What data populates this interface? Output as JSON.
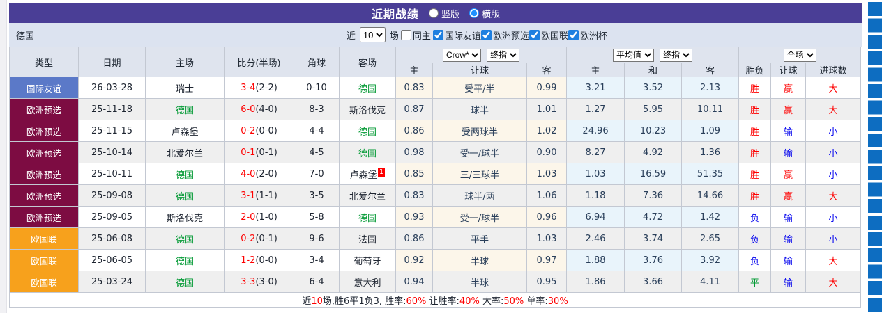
{
  "title_bar": {
    "title": "近期战绩",
    "layout_options": {
      "vertical": "竖版",
      "horizontal": "横版",
      "selected": "横版"
    }
  },
  "filter_bar": {
    "team": "德国",
    "recent_label": "近",
    "recent_value": "10",
    "matches_label": "场",
    "same_home_label": "同主",
    "same_home_checked": false,
    "competitions": [
      {
        "label": "国际友谊",
        "checked": true
      },
      {
        "label": "欧洲预选",
        "checked": true
      },
      {
        "label": "欧国联",
        "checked": true
      },
      {
        "label": "欧洲杯",
        "checked": true
      }
    ]
  },
  "table": {
    "headers": {
      "type": "类型",
      "date": "日期",
      "home": "主场",
      "score": "比分(半场)",
      "corner": "角球",
      "away": "客场",
      "odds_source_select": "Crow*",
      "odds_time_select": "终指",
      "avg_source_select": "平均值",
      "avg_time_select": "终指",
      "scope_select": "全场",
      "sub": [
        "主",
        "让球",
        "客",
        "主",
        "和",
        "客",
        "胜负",
        "让球",
        "进球数"
      ]
    },
    "rows": [
      {
        "league": "国际友谊",
        "league_type": "friendly",
        "date": "26-03-28",
        "home": "瑞士",
        "home_highlight": false,
        "score": "3-4",
        "half": "(2-2)",
        "corner": "0-10",
        "away": "德国",
        "away_highlight": true,
        "away_red_card": "",
        "crow_home": "0.83",
        "handicap": "受平/半",
        "crow_away": "0.99",
        "avg_home": "3.21",
        "avg_draw": "3.52",
        "avg_away": "2.13",
        "result": "胜",
        "result_color": "red",
        "handicap_result": "赢",
        "handicap_color": "red",
        "goals": "大",
        "goals_color": "red"
      },
      {
        "league": "欧洲预选",
        "league_type": "qualifier",
        "date": "25-11-18",
        "home": "德国",
        "home_highlight": true,
        "score": "6-0",
        "half": "(4-0)",
        "corner": "8-3",
        "away": "斯洛伐克",
        "away_highlight": false,
        "away_red_card": "",
        "crow_home": "0.87",
        "handicap": "球半",
        "crow_away": "1.01",
        "avg_home": "1.27",
        "avg_draw": "5.95",
        "avg_away": "10.11",
        "result": "胜",
        "result_color": "red",
        "handicap_result": "赢",
        "handicap_color": "red",
        "goals": "大",
        "goals_color": "red"
      },
      {
        "league": "欧洲预选",
        "league_type": "qualifier",
        "date": "25-11-15",
        "home": "卢森堡",
        "home_highlight": false,
        "score": "0-2",
        "half": "(0-0)",
        "corner": "4-4",
        "away": "德国",
        "away_highlight": true,
        "away_red_card": "",
        "crow_home": "0.86",
        "handicap": "受两球半",
        "crow_away": "1.02",
        "avg_home": "24.96",
        "avg_draw": "10.23",
        "avg_away": "1.09",
        "result": "胜",
        "result_color": "red",
        "handicap_result": "输",
        "handicap_color": "blue",
        "goals": "小",
        "goals_color": "blue"
      },
      {
        "league": "欧洲预选",
        "league_type": "qualifier",
        "date": "25-10-14",
        "home": "北爱尔兰",
        "home_highlight": false,
        "score": "0-1",
        "half": "(0-1)",
        "corner": "4-5",
        "away": "德国",
        "away_highlight": true,
        "away_red_card": "",
        "crow_home": "0.98",
        "handicap": "受一/球半",
        "crow_away": "0.90",
        "avg_home": "8.27",
        "avg_draw": "4.92",
        "avg_away": "1.36",
        "result": "胜",
        "result_color": "red",
        "handicap_result": "输",
        "handicap_color": "blue",
        "goals": "小",
        "goals_color": "blue"
      },
      {
        "league": "欧洲预选",
        "league_type": "qualifier",
        "date": "25-10-11",
        "home": "德国",
        "home_highlight": true,
        "score": "4-0",
        "half": "(2-0)",
        "corner": "7-0",
        "away": "卢森堡",
        "away_highlight": false,
        "away_red_card": "1",
        "crow_home": "0.85",
        "handicap": "三/三球半",
        "crow_away": "1.03",
        "avg_home": "1.03",
        "avg_draw": "16.59",
        "avg_away": "51.35",
        "result": "胜",
        "result_color": "red",
        "handicap_result": "赢",
        "handicap_color": "red",
        "goals": "小",
        "goals_color": "blue"
      },
      {
        "league": "欧洲预选",
        "league_type": "qualifier",
        "date": "25-09-08",
        "home": "德国",
        "home_highlight": true,
        "score": "3-1",
        "half": "(1-1)",
        "corner": "3-5",
        "away": "北爱尔兰",
        "away_highlight": false,
        "away_red_card": "",
        "crow_home": "0.83",
        "handicap": "球半/两",
        "crow_away": "1.06",
        "avg_home": "1.18",
        "avg_draw": "7.36",
        "avg_away": "14.66",
        "result": "胜",
        "result_color": "red",
        "handicap_result": "赢",
        "handicap_color": "red",
        "goals": "大",
        "goals_color": "red"
      },
      {
        "league": "欧洲预选",
        "league_type": "qualifier",
        "date": "25-09-05",
        "home": "斯洛伐克",
        "home_highlight": false,
        "score": "2-0",
        "half": "(1-0)",
        "corner": "5-8",
        "away": "德国",
        "away_highlight": true,
        "away_red_card": "",
        "crow_home": "0.93",
        "handicap": "受一/球半",
        "crow_away": "0.96",
        "avg_home": "6.94",
        "avg_draw": "4.72",
        "avg_away": "1.42",
        "result": "负",
        "result_color": "blue",
        "handicap_result": "输",
        "handicap_color": "blue",
        "goals": "小",
        "goals_color": "blue"
      },
      {
        "league": "欧国联",
        "league_type": "nations",
        "date": "25-06-08",
        "home": "德国",
        "home_highlight": true,
        "score": "0-2",
        "half": "(0-1)",
        "corner": "9-6",
        "away": "法国",
        "away_highlight": false,
        "away_red_card": "",
        "crow_home": "0.86",
        "handicap": "平手",
        "crow_away": "1.03",
        "avg_home": "2.46",
        "avg_draw": "3.74",
        "avg_away": "2.65",
        "result": "负",
        "result_color": "blue",
        "handicap_result": "输",
        "handicap_color": "blue",
        "goals": "小",
        "goals_color": "blue"
      },
      {
        "league": "欧国联",
        "league_type": "nations",
        "date": "25-06-05",
        "home": "德国",
        "home_highlight": true,
        "score": "1-2",
        "half": "(0-0)",
        "corner": "3-4",
        "away": "葡萄牙",
        "away_highlight": false,
        "away_red_card": "",
        "crow_home": "0.92",
        "handicap": "半球",
        "crow_away": "0.97",
        "avg_home": "1.88",
        "avg_draw": "3.76",
        "avg_away": "3.92",
        "result": "负",
        "result_color": "blue",
        "handicap_result": "输",
        "handicap_color": "blue",
        "goals": "大",
        "goals_color": "red"
      },
      {
        "league": "欧国联",
        "league_type": "nations",
        "date": "25-03-24",
        "home": "德国",
        "home_highlight": true,
        "score": "3-3",
        "half": "(3-0)",
        "corner": "6-4",
        "away": "意大利",
        "away_highlight": false,
        "away_red_card": "",
        "crow_home": "0.94",
        "handicap": "半球",
        "crow_away": "0.95",
        "avg_home": "1.86",
        "avg_draw": "3.66",
        "avg_away": "4.11",
        "result": "平",
        "result_color": "green",
        "handicap_result": "输",
        "handicap_color": "blue",
        "goals": "大",
        "goals_color": "red"
      }
    ]
  },
  "footer": {
    "segments": [
      {
        "text": "近",
        "color": "black"
      },
      {
        "text": "10",
        "color": "red"
      },
      {
        "text": "场,胜6平1负3, 胜率:",
        "color": "black"
      },
      {
        "text": "60%",
        "color": "red"
      },
      {
        "text": " 让胜率:",
        "color": "black"
      },
      {
        "text": "40%",
        "color": "red"
      },
      {
        "text": " 大率:",
        "color": "black"
      },
      {
        "text": "50%",
        "color": "red"
      },
      {
        "text": " 单率:",
        "color": "black"
      },
      {
        "text": "30%",
        "color": "red"
      }
    ]
  },
  "colors": {
    "title_bar_bg": "#4a3e96",
    "filter_bar_bg": "#dce3f0",
    "header_bg": "#dfe4ee",
    "league_friendly": "#5b79c8",
    "league_qualifier": "#7d0c42",
    "league_nations": "#f7a11c",
    "team_highlight": "#009933",
    "score_red": "#fe0000",
    "loss_blue": "#0000ee",
    "draw_green": "#009933",
    "crow_col_bg": "#fcf6ea",
    "avg_col_bg": "#e9f4fb",
    "side_blocks_blue": "#0d6dc1"
  }
}
